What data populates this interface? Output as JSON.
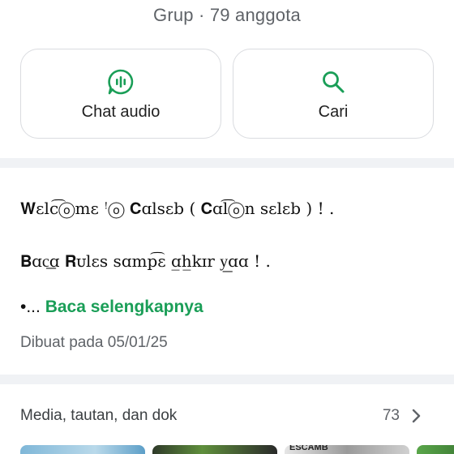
{
  "header": {
    "subtitle": "Grup · 79 anggota"
  },
  "actions": [
    {
      "label": "Chat audio",
      "icon": "audio-chat-icon"
    },
    {
      "label": "Cari",
      "icon": "search-icon"
    }
  ],
  "description": {
    "line1": "𝐖ɛlc͡ⓞmɛ ꜝⓞ 𝐂ɑlsɛb ( 𝐂ɑl͡ⓞn sɛlɛb ) ! .",
    "line2": "𝐁ɑc͟ɑ 𝐑ᴜlɛs sɑmp͡ɛ ɑ̲h̲kɪr y͟ɑɑ ! .",
    "read_more_prefix": "•...",
    "read_more": "Baca selengkapnya",
    "created": "Dibuat pada 05/01/25"
  },
  "media": {
    "title": "Media, tautan, dan dok",
    "count": "73",
    "thumb3_text": "ESCAMB"
  },
  "colors": {
    "accent": "#1a9e57",
    "divider": "#f0f2f5"
  }
}
